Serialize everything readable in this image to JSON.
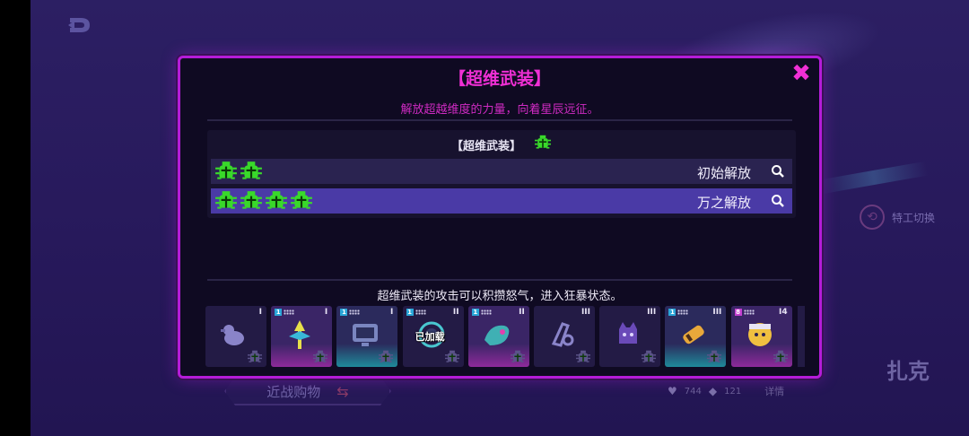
{
  "dialog": {
    "title": "【超维武装】",
    "subtitle": "解放超越维度的力量，向着星辰远征。",
    "tier_header": "【超维武装】",
    "tiers": [
      {
        "label": "初始解放",
        "bug_count": 2
      },
      {
        "label": "万之解放",
        "bug_count": 4
      }
    ],
    "footer_text": "超维武装的攻击可以积攒怒气，进入狂暴状态。",
    "weapons": [
      {
        "tier": "I",
        "rarity": "dark",
        "badge": "",
        "art": "duck-icon",
        "equipped": ""
      },
      {
        "tier": "I",
        "rarity": "pink",
        "badge": "1",
        "art": "spear-icon",
        "equipped": ""
      },
      {
        "tier": "I",
        "rarity": "teal",
        "badge": "1",
        "art": "monitor-icon",
        "equipped": ""
      },
      {
        "tier": "II",
        "rarity": "dark",
        "badge": "1",
        "art": "orb-icon",
        "equipped": "已加载"
      },
      {
        "tier": "II",
        "rarity": "pink",
        "badge": "1",
        "art": "sea-creature-icon",
        "equipped": ""
      },
      {
        "tier": "III",
        "rarity": "dark",
        "badge": "",
        "art": "claw-icon",
        "equipped": ""
      },
      {
        "tier": "III",
        "rarity": "dark",
        "badge": "",
        "art": "beast-icon",
        "equipped": ""
      },
      {
        "tier": "III",
        "rarity": "teal",
        "badge": "1",
        "art": "cannon-icon",
        "equipped": ""
      },
      {
        "tier": "I4",
        "rarity": "pink",
        "badge": "8",
        "art": "head-icon",
        "equipped": ""
      }
    ]
  },
  "background": {
    "agent_switch_label": "特工切换",
    "character_name": "扎克",
    "shop_label": "近战购物",
    "hearts": "744",
    "gems": "121",
    "detail_label": "详情"
  },
  "colors": {
    "accent": "#f02fd5",
    "border": "#b51cd9",
    "bug_green": "#39d92a",
    "row_selected": "#4a3aa6",
    "row_normal": "#2a2350"
  }
}
